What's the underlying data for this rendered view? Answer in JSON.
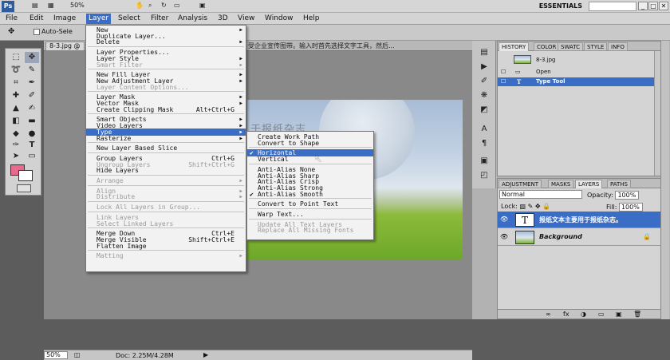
{
  "app": {
    "logo": "Ps",
    "zoom": "50%",
    "workspace": "ESSENTIALS",
    "min_label": "_",
    "max_label": "□",
    "close_label": "✕"
  },
  "menubar": [
    "File",
    "Edit",
    "Image",
    "Layer",
    "Select",
    "Filter",
    "Analysis",
    "3D",
    "View",
    "Window",
    "Help"
  ],
  "options_bar": {
    "auto_select": "Auto-Sele"
  },
  "document": {
    "tab_title": "8-3.jpg @",
    "title_overflow": "受企业宣传图带。输入时首先选择文字工具，然后...",
    "canvas_text": "于报纸杂志",
    "zoom": "50%",
    "doc_info": "Doc: 2.25M/4.28M"
  },
  "layer_menu": [
    {
      "label": "New",
      "arrow": true
    },
    {
      "label": "Duplicate Layer..."
    },
    {
      "label": "Delete",
      "arrow": true
    },
    {
      "sep": true
    },
    {
      "label": "Layer Properties..."
    },
    {
      "label": "Layer Style",
      "arrow": true
    },
    {
      "label": "Smart Filter",
      "arrow": true,
      "disabled": true
    },
    {
      "sep": true
    },
    {
      "label": "New Fill Layer",
      "arrow": true
    },
    {
      "label": "New Adjustment Layer",
      "arrow": true
    },
    {
      "label": "Layer Content Options...",
      "disabled": true
    },
    {
      "sep": true
    },
    {
      "label": "Layer Mask",
      "arrow": true
    },
    {
      "label": "Vector Mask",
      "arrow": true
    },
    {
      "label": "Create Clipping Mask",
      "shortcut": "Alt+Ctrl+G"
    },
    {
      "sep": true
    },
    {
      "label": "Smart Objects",
      "arrow": true
    },
    {
      "label": "Video Layers",
      "arrow": true
    },
    {
      "label": "Type",
      "arrow": true,
      "highlight": true
    },
    {
      "label": "Rasterize",
      "arrow": true
    },
    {
      "sep": true
    },
    {
      "label": "New Layer Based Slice"
    },
    {
      "sep": true
    },
    {
      "label": "Group Layers",
      "shortcut": "Ctrl+G"
    },
    {
      "label": "Ungroup Layers",
      "shortcut": "Shift+Ctrl+G",
      "disabled": true
    },
    {
      "label": "Hide Layers"
    },
    {
      "sep": true
    },
    {
      "label": "Arrange",
      "arrow": true,
      "disabled": true
    },
    {
      "sep": true
    },
    {
      "label": "Align",
      "arrow": true,
      "disabled": true
    },
    {
      "label": "Distribute",
      "arrow": true,
      "disabled": true
    },
    {
      "sep": true
    },
    {
      "label": "Lock All Layers in Group...",
      "disabled": true
    },
    {
      "sep": true
    },
    {
      "label": "Link Layers",
      "disabled": true
    },
    {
      "label": "Select Linked Layers",
      "disabled": true
    },
    {
      "sep": true
    },
    {
      "label": "Merge Down",
      "shortcut": "Ctrl+E"
    },
    {
      "label": "Merge Visible",
      "shortcut": "Shift+Ctrl+E"
    },
    {
      "label": "Flatten Image"
    },
    {
      "sep": true
    },
    {
      "label": "Matting",
      "arrow": true,
      "disabled": true
    }
  ],
  "type_menu": [
    {
      "label": "Create Work Path"
    },
    {
      "label": "Convert to Shape"
    },
    {
      "sep": true
    },
    {
      "label": "Horizontal",
      "checked": true,
      "highlight": true
    },
    {
      "label": "Vertical"
    },
    {
      "sep": true
    },
    {
      "label": "Anti-Alias None"
    },
    {
      "label": "Anti-Alias Sharp"
    },
    {
      "label": "Anti-Alias Crisp"
    },
    {
      "label": "Anti-Alias Strong"
    },
    {
      "label": "Anti-Alias Smooth",
      "checked": true
    },
    {
      "sep": true
    },
    {
      "label": "Convert to Point Text"
    },
    {
      "sep": true
    },
    {
      "label": "Warp Text..."
    },
    {
      "sep": true
    },
    {
      "label": "Update All Text Layers",
      "disabled": true
    },
    {
      "label": "Replace All Missing Fonts",
      "disabled": true
    }
  ],
  "history_panel": {
    "tabs": [
      "HISTORY",
      "COLOR",
      "SWATC",
      "STYLE",
      "INFO"
    ],
    "snapshot": "8-3.jpg",
    "items": [
      {
        "label": "Open",
        "selected": false
      },
      {
        "label": "Type Tool",
        "selected": true
      }
    ]
  },
  "layers_panel": {
    "tabs": [
      "ADJUSTMENT",
      "MASKS",
      "LAYERS",
      "PATHS"
    ],
    "blend_mode": "Normal",
    "opacity_label": "Opacity:",
    "opacity": "100%",
    "lock_label": "Lock:",
    "fill_label": "Fill:",
    "fill": "100%",
    "layers": [
      {
        "name": "报纸文本主要用于报纸杂志。",
        "type": "text",
        "selected": true,
        "thumb_label": "T"
      },
      {
        "name": "Background",
        "type": "image",
        "selected": false
      }
    ],
    "footer_icons": [
      "∞",
      "fx",
      "◑",
      "▭",
      "▣",
      "🗑"
    ]
  },
  "colors": {
    "foreground": "#ea6a8e",
    "background": "#ffffff",
    "highlight": "#3a6ec6"
  }
}
